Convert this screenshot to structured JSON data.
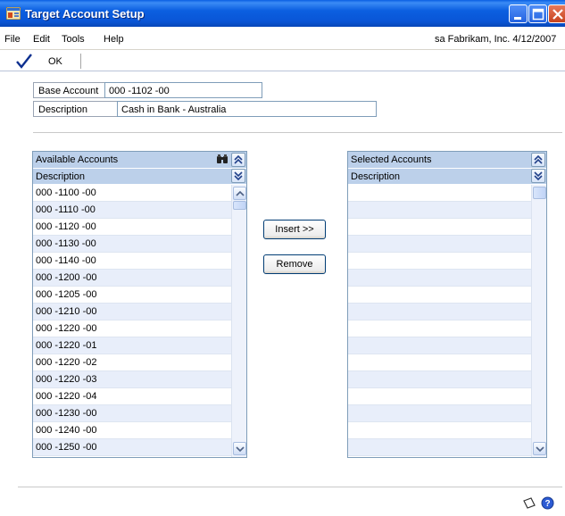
{
  "window": {
    "title": "Target Account Setup"
  },
  "menu": {
    "file": "File",
    "edit": "Edit",
    "tools": "Tools",
    "help": "Help"
  },
  "user_info": "sa  Fabrikam, Inc.  4/12/2007",
  "toolbar": {
    "ok_label": "OK"
  },
  "form": {
    "base_account_label": "Base Account",
    "base_account_value": "000 -1102 -00",
    "description_label": "Description",
    "description_value": "Cash in Bank - Australia"
  },
  "available": {
    "title": "Available Accounts",
    "column": "Description",
    "rows": [
      "000 -1100 -00",
      "000 -1110 -00",
      "000 -1120 -00",
      "000 -1130 -00",
      "000 -1140 -00",
      "000 -1200 -00",
      "000 -1205 -00",
      "000 -1210 -00",
      "000 -1220 -00",
      "000 -1220 -01",
      "000 -1220 -02",
      "000 -1220 -03",
      "000 -1220 -04",
      "000 -1230 -00",
      "000 -1240 -00",
      "000 -1250 -00"
    ]
  },
  "selected": {
    "title": "Selected Accounts",
    "column": "Description",
    "rows": []
  },
  "buttons": {
    "insert": "Insert >>",
    "remove": "Remove"
  },
  "colors": {
    "titlebar": "#0a5ee3",
    "list_header": "#bcd0ea",
    "row_alt": "#e8eefa"
  }
}
